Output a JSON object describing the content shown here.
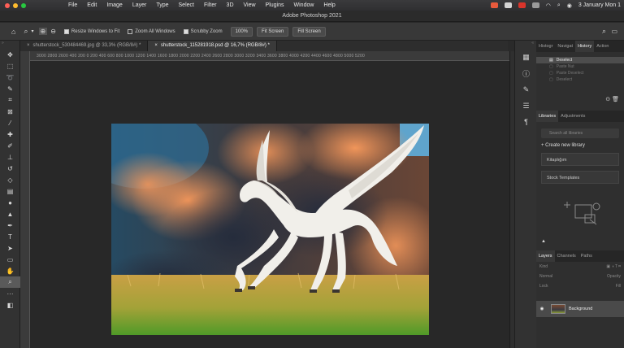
{
  "menubar": {
    "apple": "",
    "items": [
      "File",
      "Edit",
      "Image",
      "Layer",
      "Type",
      "Select",
      "Filter",
      "3D",
      "View",
      "Plugins",
      "Window",
      "Help"
    ],
    "datetime": "3 January Mon 1"
  },
  "window": {
    "title": "Adobe Photoshop 2021"
  },
  "options": {
    "resize_windows": "Resize Windows to Fit",
    "zoom_all": "Zoom All Windows",
    "scrubby_zoom": "Scrubby Zoom",
    "zoom_100": "100%",
    "fit_screen": "Fit Screen",
    "fill_screen": "Fill Screen"
  },
  "tabs": [
    {
      "label": "shutterstock_530484469.jpg @ 33,3% (RGB/8#) *"
    },
    {
      "label": "shutterstock_115281918.psd @ 16,7% (RGB/8#) *"
    }
  ],
  "ruler": {
    "labels": "3000 2800 2600 400 200 0 200 400 600 800 1000 1200 1400 1600 1800 2000 2200 2400 2600 2800 3000 3200 3400 3600 3800 4000 4200 4400 4600 4800 5000 5200"
  },
  "panels": {
    "top_tabs": [
      "Histogr",
      "Navigat",
      "History",
      "Action"
    ],
    "history_items": [
      "Deselect",
      "Paste Nut",
      "Paste Deselect",
      "Deselect"
    ],
    "lib_tabs": [
      "Libraries",
      "Adjustments"
    ],
    "lib_search": "Search all libraries",
    "create_library": "+ Create new library",
    "libraries": [
      "Kitaplığım",
      "Stock Templates"
    ],
    "layer_tabs": [
      "Layers",
      "Channels",
      "Paths"
    ],
    "layer_kind": "Kind",
    "layer_mode": "Normal",
    "layer_opacity": "Opacity",
    "layer_lock": "Lock",
    "layer_fill": "Fill",
    "layer_name": "Background"
  },
  "colors": {
    "accent": "#2d7fe0"
  }
}
